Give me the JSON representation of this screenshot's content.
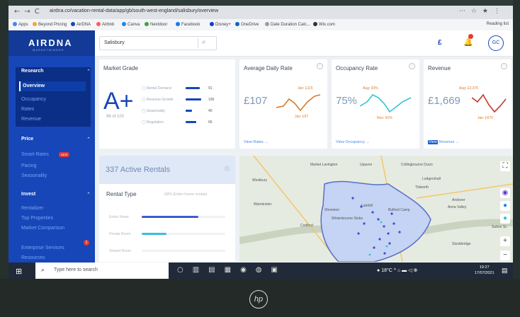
{
  "browser": {
    "url": "airdna.co/vacation-rental-data/app/gb/south-west-england/salisbury/overview",
    "bookmarks": [
      "Apps",
      "Beyond Pricing",
      "AirDNA",
      "Airbnb",
      "Canva",
      "Nextdoor",
      "Facebook",
      "Disney+",
      "OneDrive",
      "Date Duration Calc...",
      "Wix.com"
    ],
    "reading_list": "Reading list"
  },
  "brand": {
    "name": "AIRDNA",
    "tagline": "MARKETMINDER"
  },
  "sidebar": {
    "research": {
      "label": "Research",
      "items": [
        "Overview",
        "Occupancy",
        "Rates",
        "Revenue"
      ]
    },
    "price": {
      "label": "Price",
      "items": [
        "Smart Rates",
        "Pacing",
        "Seasonality"
      ],
      "new_badge": "NEW"
    },
    "invest": {
      "label": "Invest",
      "items": [
        "Rentalizer",
        "Top Properties",
        "Market Comparison"
      ]
    },
    "enterprise": "Enterprise Services",
    "enterprise_badge": "1",
    "resources": "Resources"
  },
  "topbar": {
    "search_value": "Salisbury",
    "currency": "£",
    "avatar": "GC"
  },
  "market_grade": {
    "title": "Market Grade",
    "grade": "A+",
    "score": "96 of 100",
    "factors": [
      {
        "label": "Rental Demand",
        "value": "91",
        "fill": 0.91
      },
      {
        "label": "Revenue Growth",
        "value": "100",
        "fill": 1.0
      },
      {
        "label": "Seasonality",
        "value": "40",
        "fill": 0.4
      },
      {
        "label": "Regulation",
        "value": "66",
        "fill": 0.66
      }
    ]
  },
  "adr": {
    "title": "Average Daily Rate",
    "value": "£107",
    "high": "Jan: £115",
    "low": "Jan: £97",
    "link": "View Rates →"
  },
  "occupancy": {
    "title": "Occupancy Rate",
    "value": "75%",
    "high": "Aug: 93%",
    "low": "Nov: 41%",
    "link": "View Occupancy →"
  },
  "revenue": {
    "title": "Revenue",
    "value": "£1,669",
    "high": "Aug: £2,376",
    "low": "Jan: £670",
    "link_highlight": "View",
    "link_rest": " Revenue →"
  },
  "rentals": {
    "title": "337 Active Rentals",
    "type_label": "Rental Type",
    "type_note": "68% Entire home rentals",
    "rows": [
      {
        "label": "Entire Home",
        "fill": 0.68,
        "color": "#3f5bd1"
      },
      {
        "label": "Private Room",
        "fill": 0.3,
        "color": "#3dbde0"
      },
      {
        "label": "Shared Room",
        "fill": 0.0,
        "color": "#3dbde0"
      }
    ]
  },
  "map": {
    "labels": [
      "Market Lavington",
      "Upavon",
      "Collingbourne Ducis",
      "Westbury",
      "Ludgershall",
      "Tidworth",
      "Warminster",
      "Andover",
      "Anna Valley",
      "Shrewton",
      "Larkhill",
      "Bulford Camp",
      "Winterbourne Stoke",
      "Codford",
      "Stockbridge",
      "Sutton Sc"
    ],
    "zoom_in": "+",
    "zoom_out": "−"
  },
  "taskbar": {
    "search_placeholder": "Type here to search",
    "weather": "18°C",
    "time": "19:27",
    "date": "17/07/2021"
  },
  "hardware": {
    "logo": "hp"
  }
}
